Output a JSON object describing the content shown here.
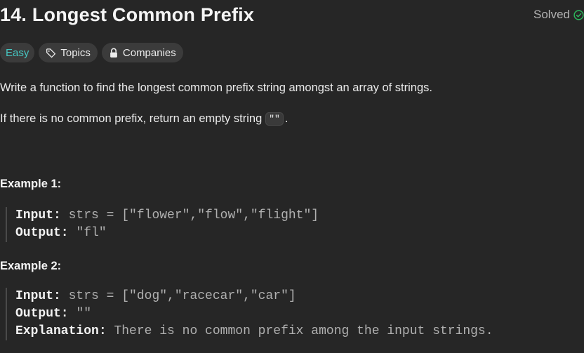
{
  "problem": {
    "title": "14. Longest Common Prefix",
    "status": "Solved",
    "status_color": "#2cbb5d"
  },
  "tags": {
    "difficulty": "Easy",
    "difficulty_color": "#46c6c2",
    "topics": "Topics",
    "companies": "Companies"
  },
  "description": {
    "line1": "Write a function to find the longest common prefix string amongst an array of strings.",
    "line2_before": "If there is no common prefix, return an empty string",
    "line2_code": "\"\"",
    "line2_after": "."
  },
  "examples": [
    {
      "heading": "Example 1:",
      "input_label": "Input:",
      "input_value": "strs = [\"flower\",\"flow\",\"flight\"]",
      "output_label": "Output:",
      "output_value": "\"fl\""
    },
    {
      "heading": "Example 2:",
      "input_label": "Input:",
      "input_value": "strs = [\"dog\",\"racecar\",\"car\"]",
      "output_label": "Output:",
      "output_value": "\"\"",
      "explanation_label": "Explanation:",
      "explanation_value": "There is no common prefix among the input strings."
    }
  ],
  "icons": {
    "solved": "check-circle-icon",
    "topics": "tag-icon",
    "companies": "lock-icon"
  }
}
